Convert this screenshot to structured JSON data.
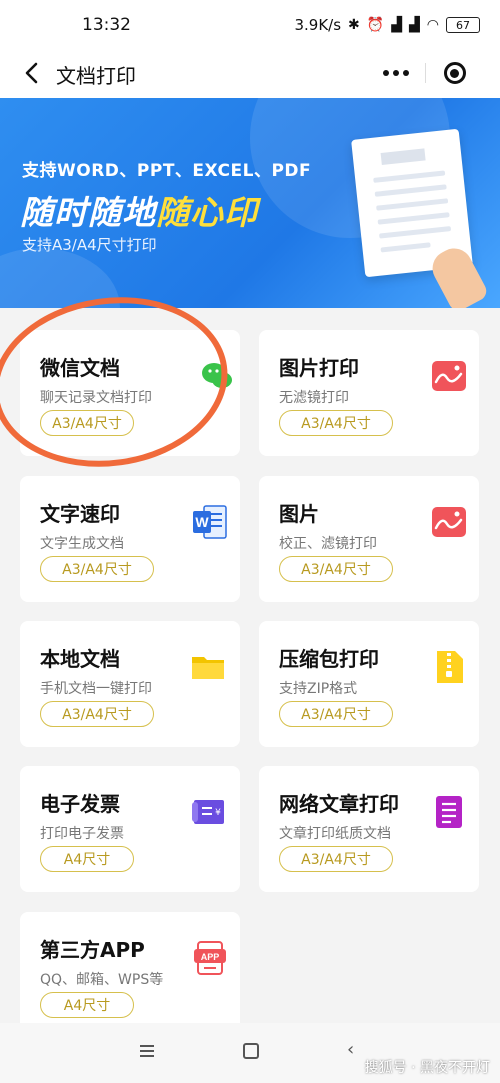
{
  "status_bar": {
    "time": "13:32",
    "speed": "3.9K/s",
    "battery": "67",
    "icons": [
      "bluetooth-icon",
      "alarm-icon",
      "signal-hd-icon",
      "signal-hd-icon",
      "wifi-icon"
    ]
  },
  "nav": {
    "title": "文档打印"
  },
  "banner": {
    "line1": "支持WORD、PPT、EXCEL、PDF",
    "line2_a": "随时随地",
    "line2_b": "随心印",
    "line3": "支持A3/A4尺寸打印"
  },
  "cards": [
    {
      "title": "微信文档",
      "sub": "聊天记录文档打印",
      "tag": "A3/A4尺寸",
      "icon": "wechat-icon"
    },
    {
      "title": "图片打印",
      "sub": "无滤镜打印",
      "tag": "A3/A4尺寸",
      "icon": "image-icon"
    },
    {
      "title": "文字速印",
      "sub": "文字生成文档",
      "tag": "A3/A4尺寸",
      "icon": "word-icon"
    },
    {
      "title": "图片",
      "sub": "校正、滤镜打印",
      "tag": "A3/A4尺寸",
      "icon": "image-icon"
    },
    {
      "title": "本地文档",
      "sub": "手机文档一键打印",
      "tag": "A3/A4尺寸",
      "icon": "folder-icon"
    },
    {
      "title": "压缩包打印",
      "sub": "支持ZIP格式",
      "tag": "A3/A4尺寸",
      "icon": "zip-icon"
    },
    {
      "title": "电子发票",
      "sub": "打印电子发票",
      "tag": "A4尺寸",
      "icon": "invoice-icon"
    },
    {
      "title": "网络文章打印",
      "sub": "文章打印纸质文档",
      "tag": "A3/A4尺寸",
      "icon": "article-icon"
    },
    {
      "title": "第三方APP",
      "sub": "QQ、邮箱、WPS等",
      "tag": "A4尺寸",
      "icon": "app-icon"
    }
  ],
  "app_icon_text": "APP",
  "word_icon_text": "W",
  "watermark": "搜狐号 · 黑夜不开灯",
  "colors": {
    "banner": "#2f8ef0",
    "highlight": "#ffdf3b",
    "tag_border": "#d6c04d",
    "annotation_circle": "#f06a3a"
  }
}
